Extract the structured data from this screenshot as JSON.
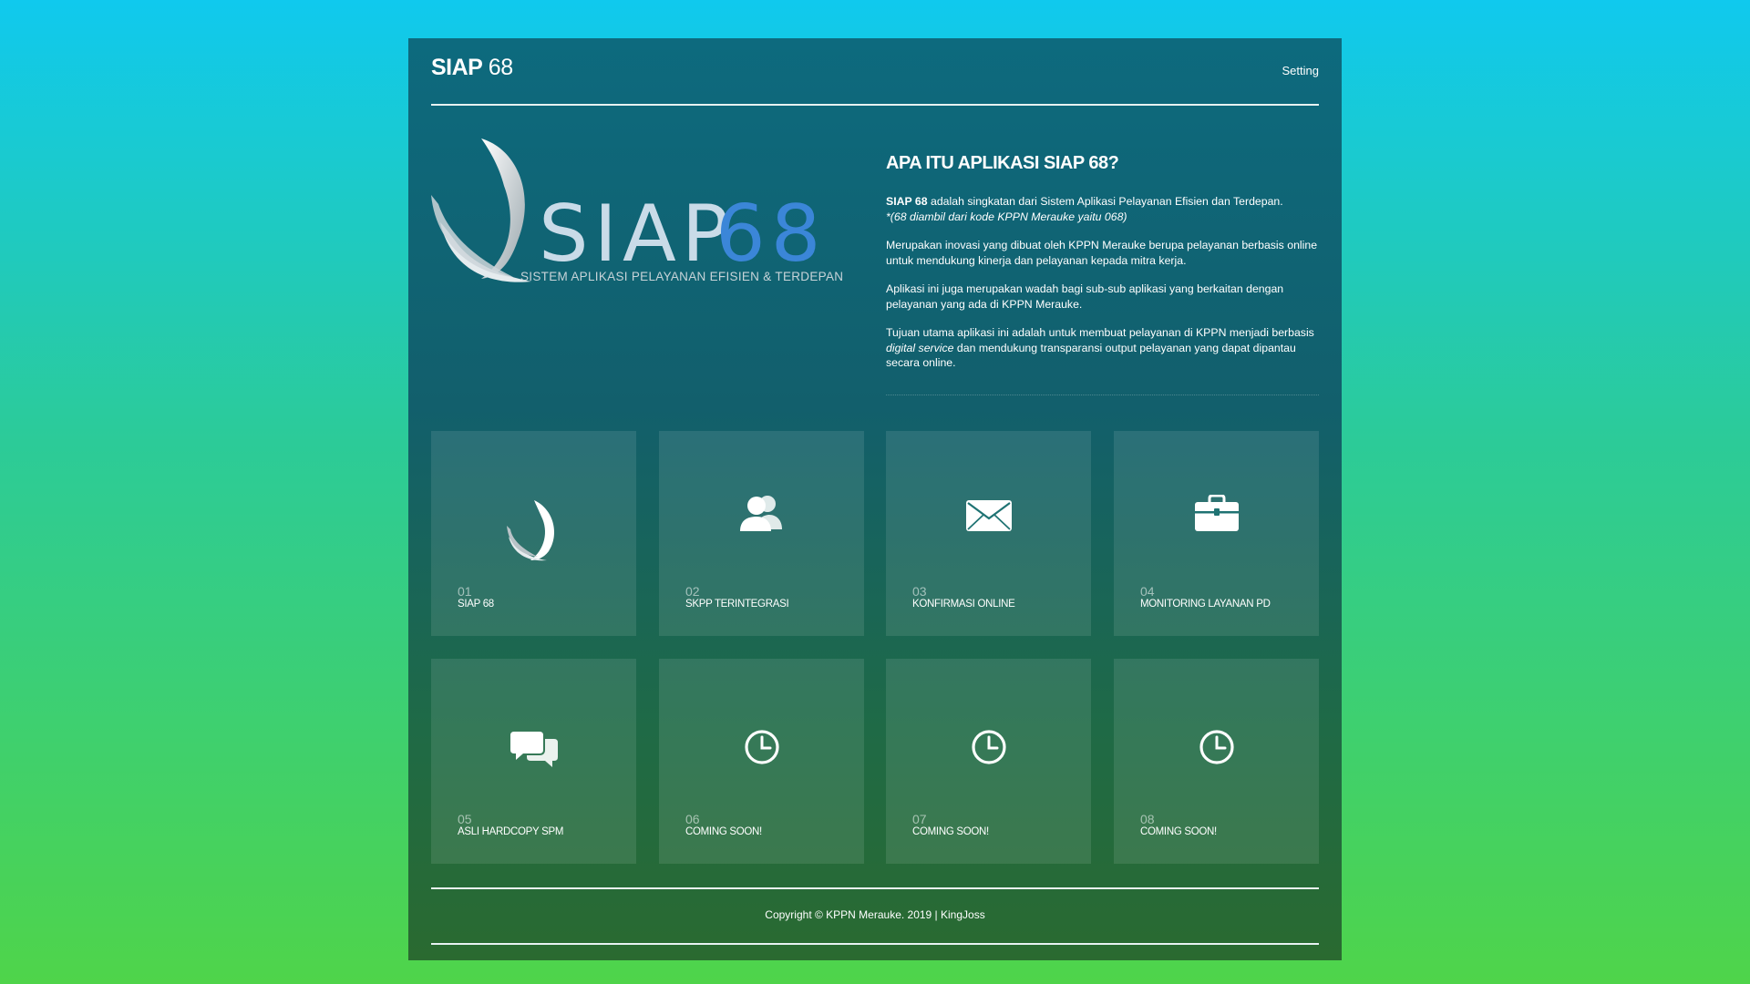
{
  "header": {
    "brand_bold": "SIAP",
    "brand_rest": " 68",
    "setting_label": "Setting"
  },
  "logo": {
    "wordmark_left": "SIAP",
    "wordmark_right": "68",
    "tagline": "SISTEM APLIKASI PELAYANAN EFISIEN & TERDEPAN"
  },
  "about": {
    "title": "APA ITU APLIKASI SIAP 68?",
    "p1_bold": "SIAP 68",
    "p1_rest": " adalah singkatan dari Sistem Aplikasi Pelayanan Efisien dan Terdepan.",
    "p1_note": "*(68 diambil dari kode KPPN Merauke yaitu 068)",
    "p2": "Merupakan inovasi yang dibuat oleh KPPN Merauke berupa pelayanan berbasis online untuk mendukung kinerja dan pelayanan kepada mitra kerja.",
    "p3": "Aplikasi ini juga merupakan wadah bagi sub-sub aplikasi yang berkaitan dengan pelayanan yang ada di KPPN Merauke.",
    "p4_start": "Tujuan utama aplikasi ini adalah untuk membuat pelayanan di KPPN menjadi berbasis ",
    "p4_italic": "digital service",
    "p4_end": " dan mendukung transparansi output pelayanan yang dapat dipantau secara online."
  },
  "tiles": [
    {
      "num": "01",
      "label": "SIAP 68",
      "icon": "siap-logo-icon"
    },
    {
      "num": "02",
      "label": "SKPP TERINTEGRASI",
      "icon": "users-icon"
    },
    {
      "num": "03",
      "label": "KONFIRMASI ONLINE",
      "icon": "envelope-icon"
    },
    {
      "num": "04",
      "label": "MONITORING LAYANAN PD",
      "icon": "briefcase-icon"
    },
    {
      "num": "05",
      "label": "ASLI HARDCOPY SPM",
      "icon": "chat-icon"
    },
    {
      "num": "06",
      "label": "COMING SOON!",
      "icon": "clock-icon"
    },
    {
      "num": "07",
      "label": "COMING SOON!",
      "icon": "clock-icon"
    },
    {
      "num": "08",
      "label": "COMING SOON!",
      "icon": "clock-icon"
    }
  ],
  "footer": {
    "copyright": "Copyright © KPPN Merauke. 2019 | KingJoss"
  }
}
